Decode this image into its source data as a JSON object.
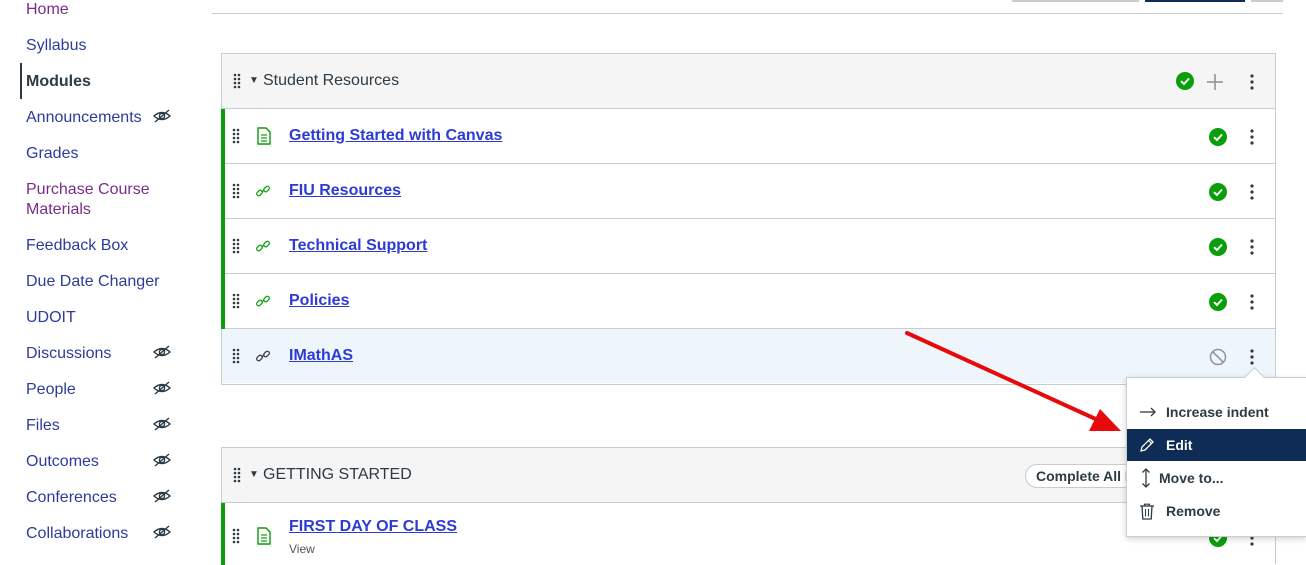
{
  "nav": {
    "items": [
      {
        "label": "Home",
        "style": "purple",
        "hidden": false
      },
      {
        "label": "Syllabus",
        "style": "normal",
        "hidden": false
      },
      {
        "label": "Modules",
        "style": "active",
        "hidden": false
      },
      {
        "label": "Announcements",
        "style": "normal",
        "hidden": true
      },
      {
        "label": "Grades",
        "style": "normal",
        "hidden": false
      },
      {
        "label": "Purchase Course",
        "label2": "Materials",
        "style": "purple",
        "hidden": false
      },
      {
        "label": "Feedback Box",
        "style": "normal",
        "hidden": false
      },
      {
        "label": "Due Date Changer",
        "style": "normal",
        "hidden": false
      },
      {
        "label": "UDOIT",
        "style": "normal",
        "hidden": false
      },
      {
        "label": "Discussions",
        "style": "normal",
        "hidden": true
      },
      {
        "label": "People",
        "style": "normal",
        "hidden": true
      },
      {
        "label": "Files",
        "style": "normal",
        "hidden": true
      },
      {
        "label": "Outcomes",
        "style": "normal",
        "hidden": true
      },
      {
        "label": "Conferences",
        "style": "normal",
        "hidden": true
      },
      {
        "label": "Collaborations",
        "style": "normal",
        "hidden": true
      }
    ]
  },
  "modules": [
    {
      "title": "Student Resources",
      "published": true,
      "items": [
        {
          "title": "Getting Started with Canvas",
          "type": "page-icon",
          "published": true
        },
        {
          "title": "FIU Resources",
          "type": "link-icon",
          "published": true
        },
        {
          "title": "Technical Support",
          "type": "link-icon",
          "published": true
        },
        {
          "title": "Policies",
          "type": "link-icon",
          "published": true
        },
        {
          "title": "IMathAS",
          "type": "link-icon",
          "published": false
        }
      ]
    },
    {
      "title": "GETTING STARTED",
      "complete_all_label": "Complete All Items",
      "items": [
        {
          "title": "FIRST DAY OF CLASS",
          "subtitle": "View",
          "type": "page-icon",
          "published": true
        }
      ]
    }
  ],
  "context_menu": {
    "items": [
      {
        "label": "Increase indent",
        "icon": "arrow-right-icon"
      },
      {
        "label": "Edit",
        "icon": "pencil-icon",
        "selected": true
      },
      {
        "label": "Move to...",
        "icon": "move-icon"
      },
      {
        "label": "Remove",
        "icon": "trash-icon"
      }
    ]
  },
  "colors": {
    "published": "#0b9e0b",
    "link": "#2d3bd4",
    "menu_selected": "#0e2c55",
    "annotation_arrow": "#e8090c"
  }
}
